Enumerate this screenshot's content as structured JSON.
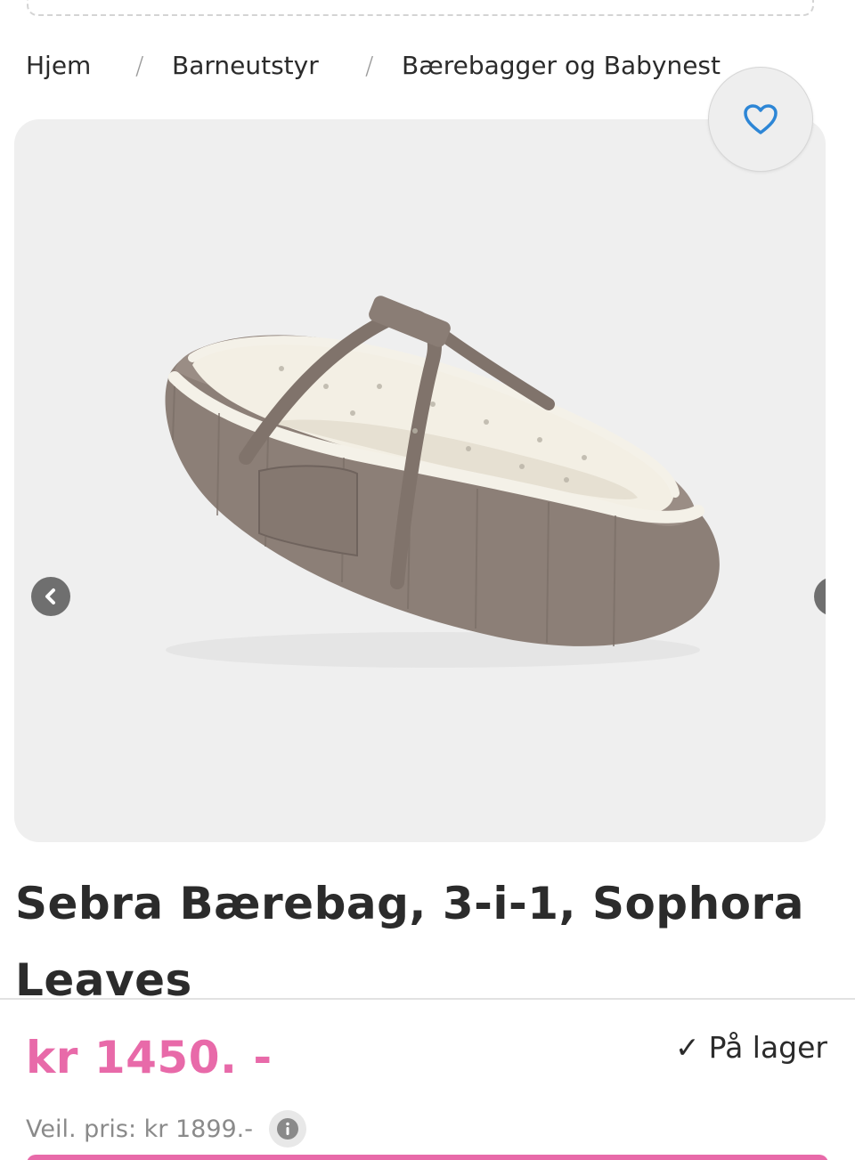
{
  "breadcrumb": {
    "items": [
      "Hjem",
      "Barneutstyr",
      "Bærebagger og Babynest"
    ],
    "separator": "/"
  },
  "gallery": {
    "image_alt": "Sebra Bærebag, 3-i-1, Sophora Leaves",
    "favorite_icon": "heart-icon",
    "prev_icon": "chevron-left-icon",
    "next_icon": "chevron-right-icon"
  },
  "product": {
    "title": "Sebra Bærebag, 3-i-1, Sophora Leaves",
    "price": "kr 1450. -",
    "stock_check": "✓",
    "stock_label": "På lager",
    "rrp": "Veil. pris: kr 1899.-",
    "info_icon": "info-icon"
  },
  "colors": {
    "accent": "#e86aa9",
    "text": "#2b2b2b",
    "muted": "#8a8a8a",
    "gallery_bg": "#efefef",
    "heart": "#2d86d6"
  }
}
